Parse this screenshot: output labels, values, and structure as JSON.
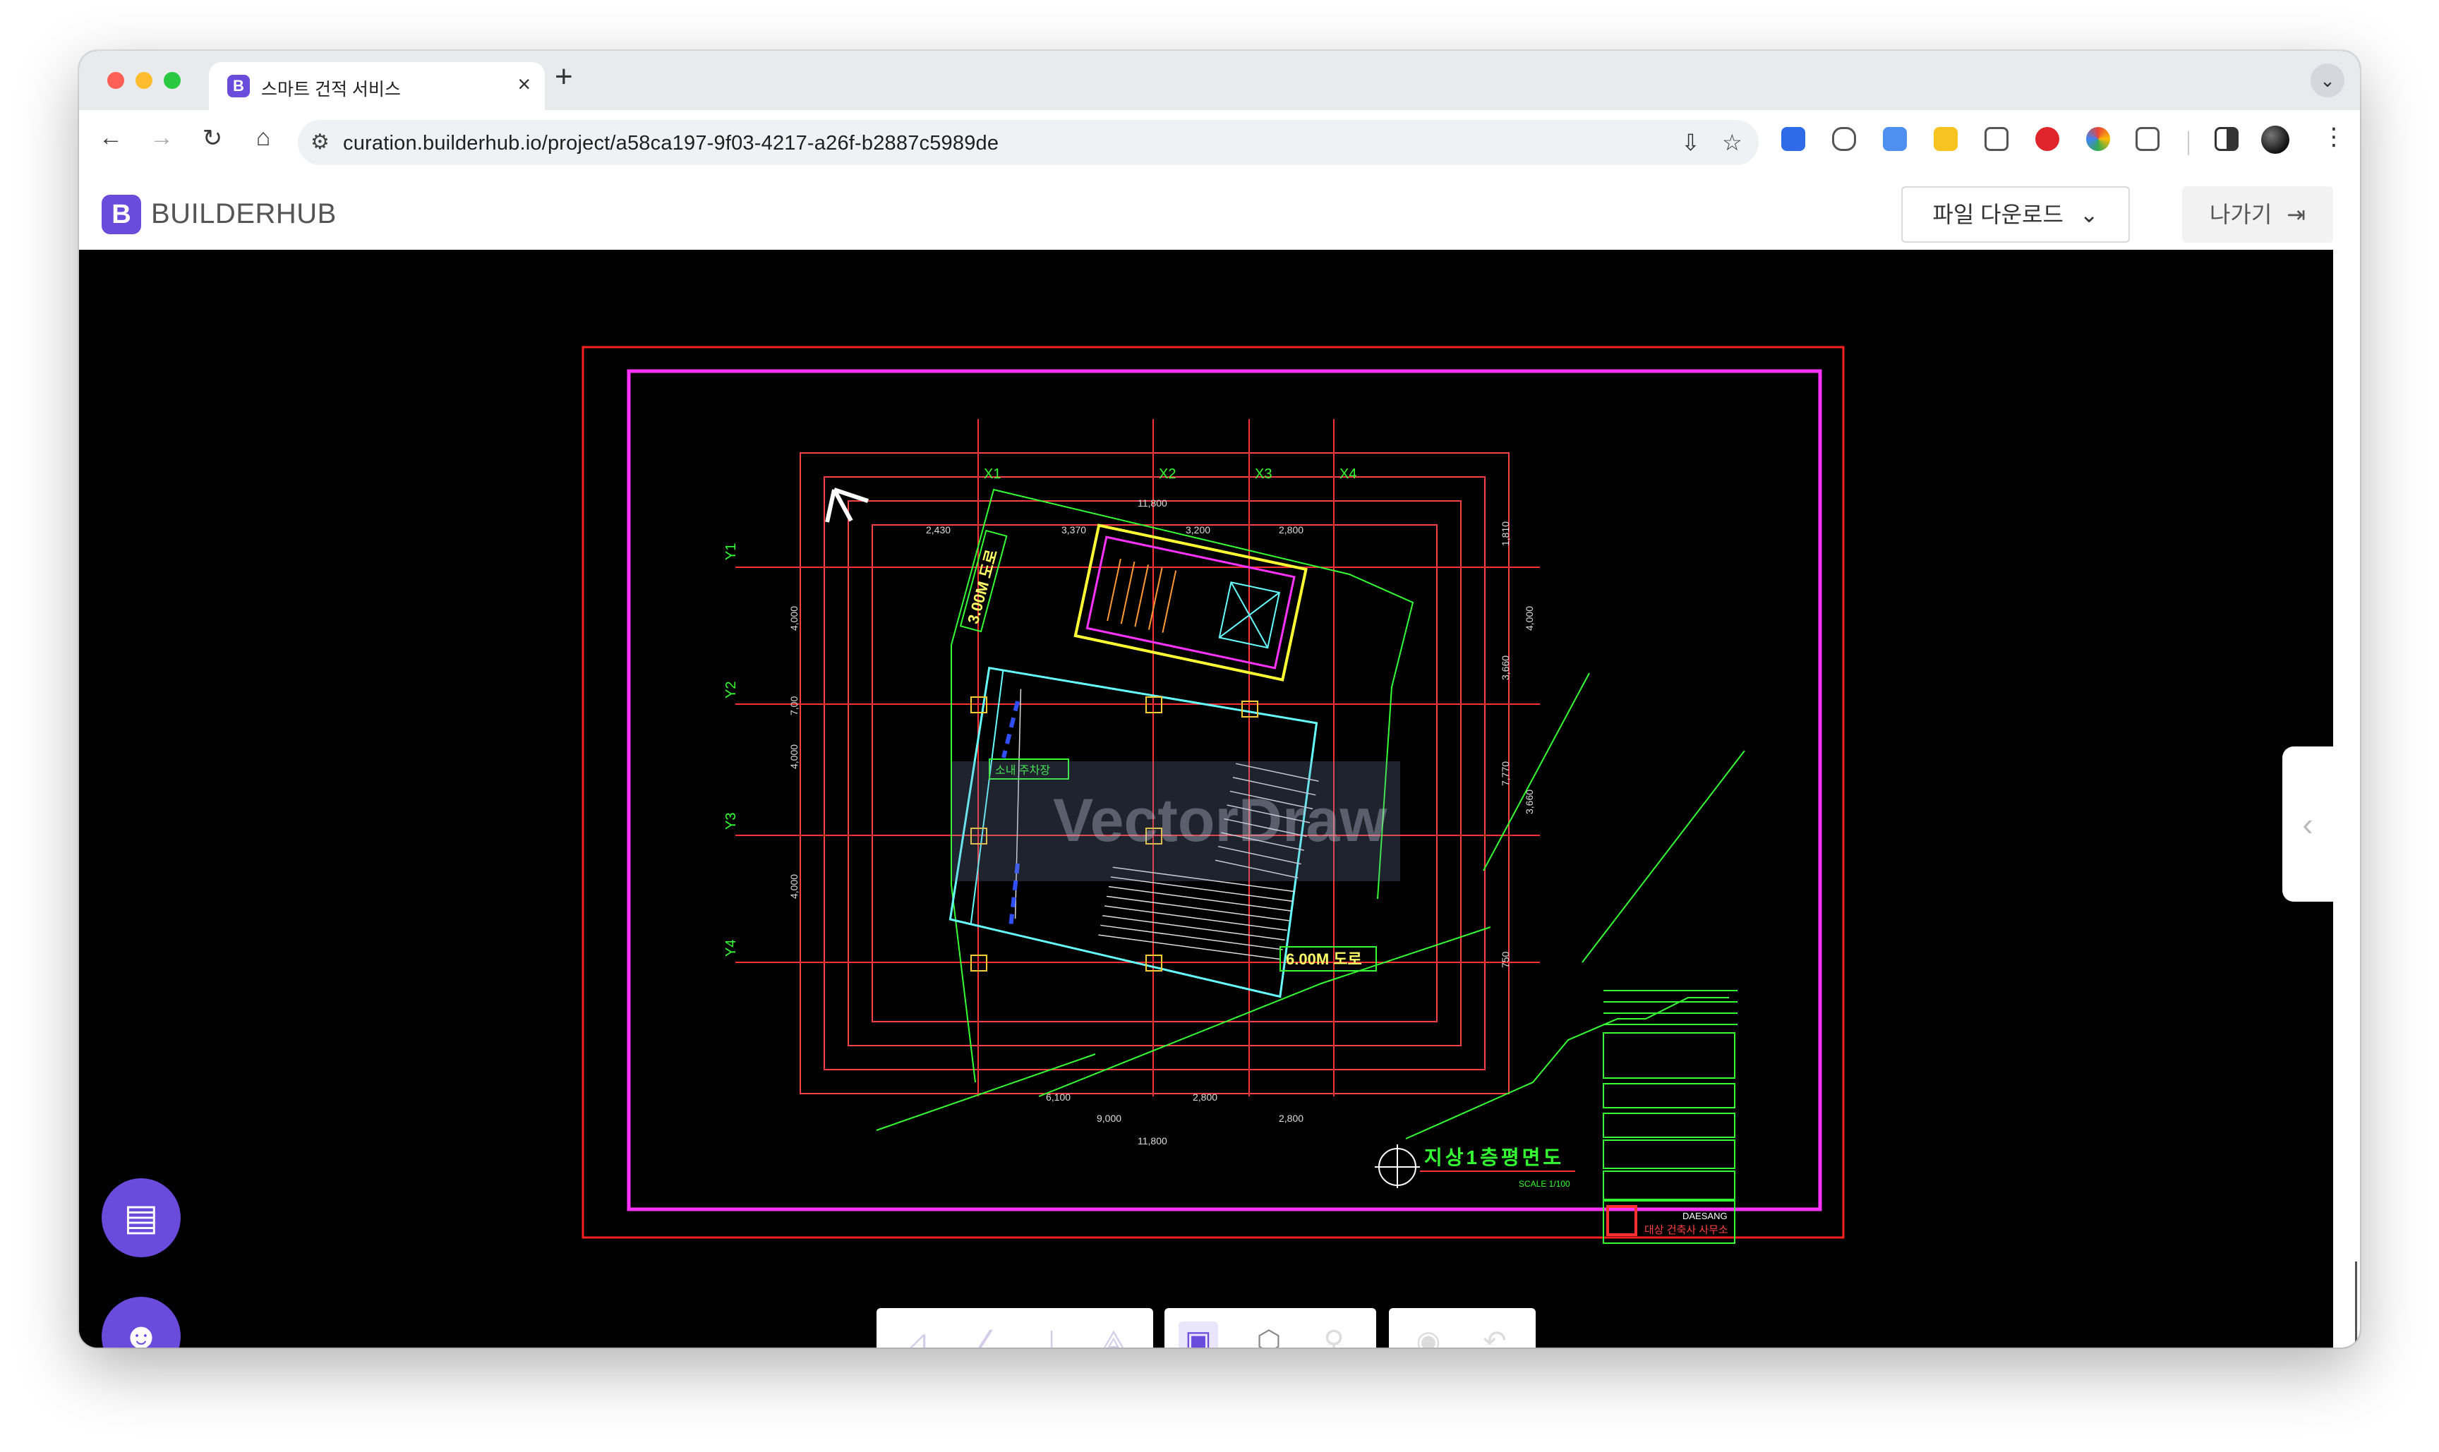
{
  "browser": {
    "tab_title": "스마트 건적 서비스",
    "url": "curation.builderhub.io/project/a58ca197-9f03-4217-a26f-b2887c5989de"
  },
  "app": {
    "logo_mark": "B",
    "logo_text": "BUILDERHUB",
    "download_button": "파일 다운로드",
    "exit_button": "나가기"
  },
  "drawing": {
    "grid_x": [
      "X1",
      "X2",
      "X3",
      "X4"
    ],
    "grid_y": [
      "Y1",
      "Y2",
      "Y3",
      "Y4"
    ],
    "dims_top": [
      "2,430",
      "3,370",
      "3,200",
      "2,800"
    ],
    "dim_total_top": "11,800",
    "dims_bottom": [
      "6,100",
      "2,800"
    ],
    "dims_bottom2": [
      "9,000",
      "2,800"
    ],
    "dim_total_bottom": "11,800",
    "dims_left": [
      "4,000",
      "7,00",
      "4,000",
      "4,000"
    ],
    "dims_right": [
      "1,810",
      "4,000",
      "3,660",
      "7,770",
      "3,660",
      "750"
    ],
    "road_top": "3.00M 도로",
    "road_bottom": "6.00M 도로",
    "parking_label": "소내 주차장",
    "plan_title": "지상1층평면도",
    "plan_scale": "SCALE 1/100",
    "watermark": "VectorDraw",
    "company_en": "DAESANG",
    "company_ko": "대상 건축사 사무소"
  },
  "icons": {
    "toolbar_group1": [
      "measure-distance-icon",
      "measure-angle-icon",
      "measure-point-icon",
      "measure-area-icon"
    ],
    "toolbar_group2": [
      "layout-view-icon",
      "3d-box-icon",
      "person-icon"
    ],
    "toolbar_group3": [
      "eye-icon",
      "undo-icon"
    ],
    "fabs": [
      "chat-icon",
      "ai-assistant-icon"
    ]
  },
  "colors": {
    "brand": "#6a4bdc",
    "cad_background": "#000000",
    "frame_red": "#ff2020",
    "frame_magenta": "#ff33ff",
    "cad_green": "#33ff33"
  }
}
